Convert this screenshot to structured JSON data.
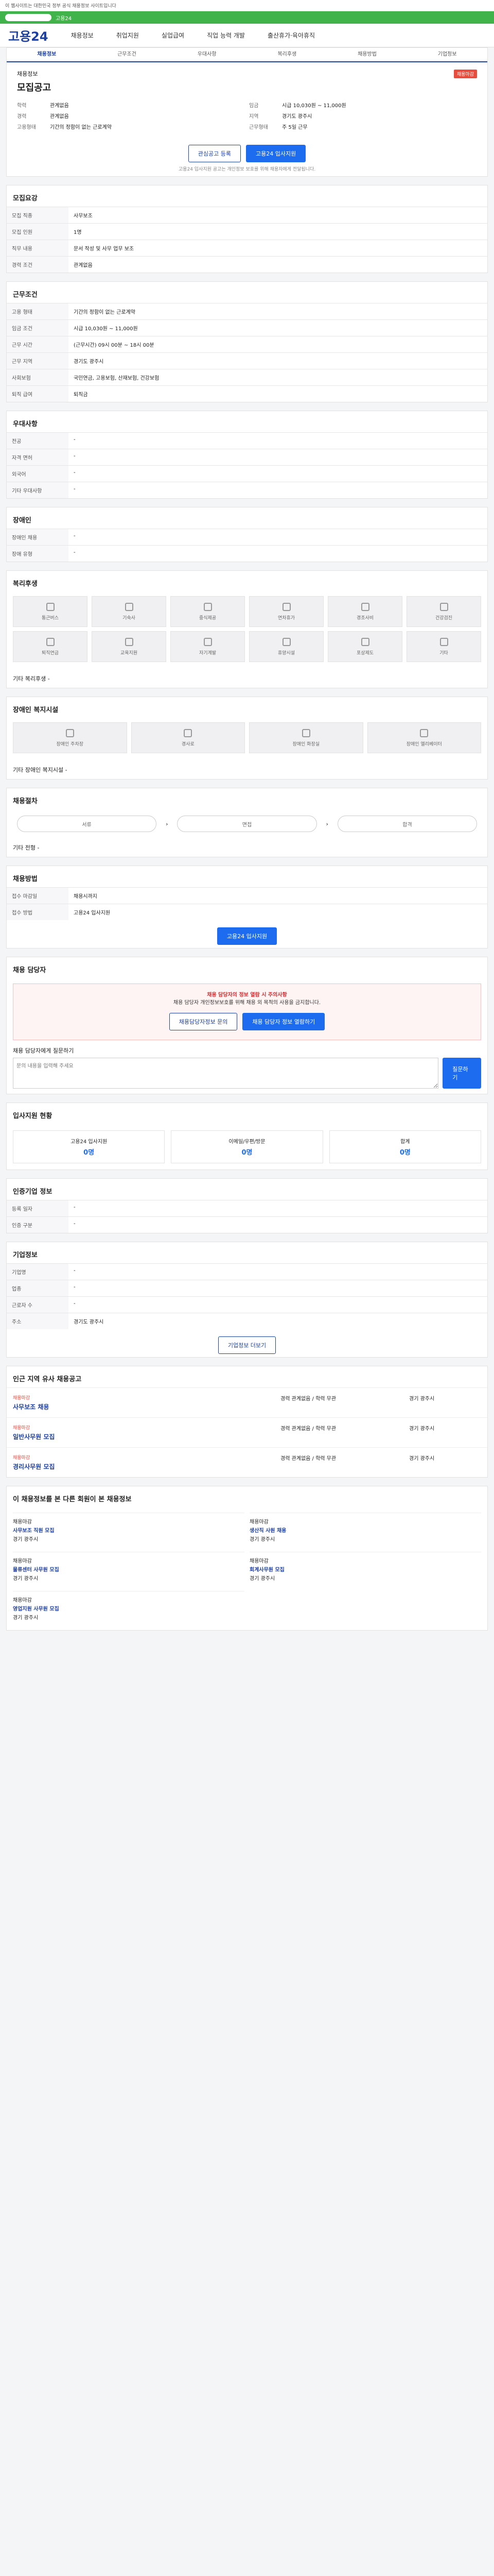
{
  "header": {
    "topnote": "이 웹사이트는 대한민국 정부 공식 채용정보 사이트입니다",
    "greenbar_text": "고용24",
    "logo": "고용24",
    "nav": [
      "채용정보",
      "취업지원",
      "실업급여",
      "직업 능력 개발",
      "출산휴가·육아휴직"
    ]
  },
  "tabs": [
    "채용정보",
    "근무조건",
    "우대사항",
    "복리후생",
    "채용방법",
    "기업정보"
  ],
  "hero": {
    "tag": "채용정보",
    "badge": "채용마감",
    "title": "모집공고",
    "rows": [
      {
        "k1": "학력",
        "v1": "관계없음",
        "k2": "임금",
        "v2": "시급 10,030원 ~ 11,000원"
      },
      {
        "k1": "경력",
        "v1": "관계없음",
        "k2": "지역",
        "v2": "경기도 광주시"
      },
      {
        "k1": "고용형태",
        "v1": "기간의 정함이 없는 근로계약",
        "k2": "근무형태",
        "v2": "주 5일 근무"
      }
    ],
    "btn_interest": "관심공고 등록",
    "btn_apply": "고용24 입사지원",
    "note": "고용24 입사지원 공고는 개인정보 보호를 위해 채용자에게 전달됩니다."
  },
  "sections": {
    "recruit": {
      "title": "모집요강",
      "rows": [
        {
          "th": "모집 직종",
          "td": "사무보조"
        },
        {
          "th": "모집 인원",
          "td": "1명"
        },
        {
          "th": "직무 내용",
          "td": "문서 작성 및 사무 업무 보조"
        },
        {
          "th": "경력 조건",
          "td": "관계없음"
        }
      ]
    },
    "conditions": {
      "title": "근무조건",
      "rows": [
        {
          "th": "고용 형태",
          "td": "기간의 정함이 없는 근로계약"
        },
        {
          "th": "임금 조건",
          "td": "시급 10,030원 ~ 11,000원"
        },
        {
          "th": "근무 시간",
          "td": "(근무시간) 09시 00분 ~ 18시 00분"
        },
        {
          "th": "근무 지역",
          "td": "경기도 광주시"
        },
        {
          "th": "사회보험",
          "td": "국민연금, 고용보험, 산재보험, 건강보험"
        },
        {
          "th": "퇴직 급여",
          "td": "퇴직금"
        }
      ]
    },
    "preference": {
      "title": "우대사항",
      "rows": [
        {
          "th": "전공",
          "td": "-"
        },
        {
          "th": "자격 면허",
          "td": "-"
        },
        {
          "th": "외국어",
          "td": "-"
        },
        {
          "th": "기타 우대사항",
          "td": "-"
        }
      ]
    },
    "disability": {
      "title": "장애인",
      "rows": [
        {
          "th": "장애인 채용",
          "td": "-"
        },
        {
          "th": "장애 유형",
          "td": "-"
        }
      ]
    },
    "welfare": {
      "title": "복리후생",
      "items": [
        "통근버스",
        "기숙사",
        "중식제공",
        "연차휴가",
        "경조사비",
        "건강검진",
        "퇴직연금",
        "교육지원",
        "자기계발",
        "휴양시설",
        "포상제도",
        "기타"
      ],
      "note": "기타 복리후생 -"
    },
    "welfare2": {
      "title": "장애인 복지시설",
      "items": [
        "장애인 주차장",
        "경사로",
        "장애인 화장실",
        "장애인 엘리베이터"
      ],
      "note": "기타 장애인 복지시설 -"
    },
    "process": {
      "title": "채용절차",
      "steps": [
        "서류",
        "면접",
        "합격"
      ],
      "note": "기타 전형 -"
    },
    "method": {
      "title": "채용방법",
      "rows": [
        {
          "th": "접수 마감일",
          "td": "채용시까지"
        },
        {
          "th": "접수 방법",
          "td": "고용24 입사지원"
        }
      ],
      "btn": "고용24 입사지원"
    },
    "contact": {
      "title": "채용 담당자",
      "alert_title": "채용 담당자의 정보 열람 시 주의사항",
      "alert_text": "채용 담당자 개인정보보호를 위해 채용 외 목적의 사용을 금지합니다.",
      "btn_a": "채용담당자정보 문의",
      "btn_b": "채용 담당자 정보 열람하기",
      "question_label": "채용 담당자에게 질문하기",
      "question_placeholder": "문의 내용을 입력해 주세요",
      "question_btn": "질문하기"
    },
    "stats": {
      "title": "입사지원 현황",
      "items": [
        {
          "label": "고용24 입사지원",
          "value": "0명"
        },
        {
          "label": "이메일/우편/방문",
          "value": "0명"
        },
        {
          "label": "합계",
          "value": "0명"
        }
      ]
    },
    "info": {
      "title": "인증기업 정보",
      "rows": [
        {
          "th": "등록 일자",
          "td": "-"
        },
        {
          "th": "인증 구분",
          "td": "-"
        }
      ]
    },
    "company": {
      "title": "기업정보",
      "rows": [
        {
          "th": "기업명",
          "td": "-"
        },
        {
          "th": "업종",
          "td": "-"
        },
        {
          "th": "근로자 수",
          "td": "-"
        },
        {
          "th": "주소",
          "td": "경기도 광주시"
        }
      ],
      "btn": "기업정보 더보기"
    },
    "related": {
      "title": "인근 지역 유사 채용공고",
      "jobs": [
        {
          "co": "채용마감",
          "title": "사무보조 채용",
          "cond": "경력 관계없음 / 학력 무관",
          "loc": "경기 광주시"
        },
        {
          "co": "채용마감",
          "title": "일반사무원 모집",
          "cond": "경력 관계없음 / 학력 무관",
          "loc": "경기 광주시"
        },
        {
          "co": "채용마감",
          "title": "경리사무원 모집",
          "cond": "경력 관계없음 / 학력 무관",
          "loc": "경기 광주시"
        }
      ]
    },
    "recommend": {
      "title": "이 채용정보를 본 다른 회원이 본 채용정보",
      "items": [
        {
          "tag": "채용마감",
          "title": "사무보조 직원 모집",
          "sub": "경기 광주시"
        },
        {
          "tag": "채용마감",
          "title": "생산직 사원 채용",
          "sub": "경기 광주시"
        },
        {
          "tag": "채용마감",
          "title": "물류센터 사무원 모집",
          "sub": "경기 광주시"
        },
        {
          "tag": "채용마감",
          "title": "회계사무원 모집",
          "sub": "경기 광주시"
        },
        {
          "tag": "채용마감",
          "title": "영업지원 사무원 모집",
          "sub": "경기 광주시"
        }
      ]
    }
  }
}
